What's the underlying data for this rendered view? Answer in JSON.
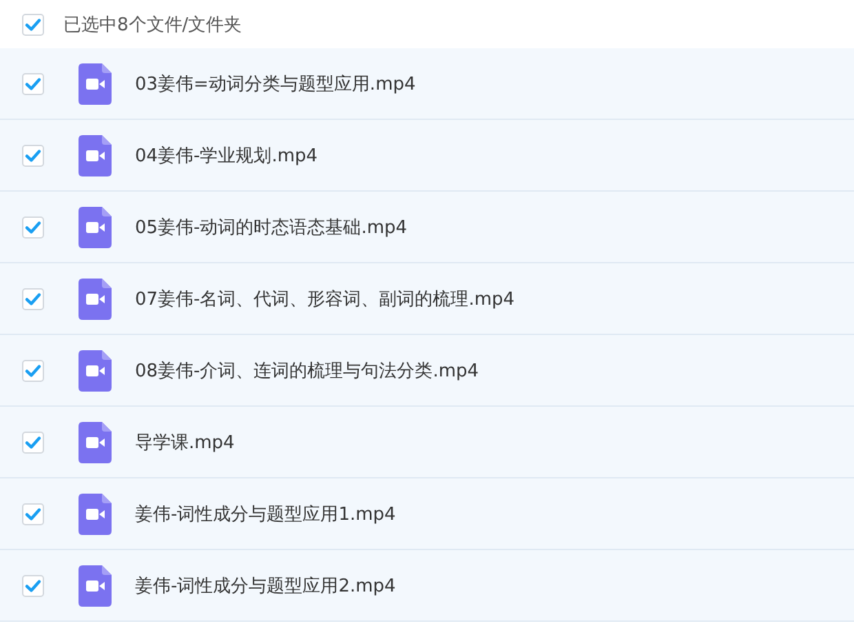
{
  "header": {
    "checked": true,
    "label": "已选中8个文件/文件夹"
  },
  "files": [
    {
      "name": "03姜伟=动词分类与题型应用.mp4",
      "checked": true
    },
    {
      "name": "04姜伟-学业规划.mp4",
      "checked": true
    },
    {
      "name": "05姜伟-动词的时态语态基础.mp4",
      "checked": true
    },
    {
      "name": "07姜伟-名词、代词、形容词、副词的梳理.mp4",
      "checked": true
    },
    {
      "name": "08姜伟-介词、连词的梳理与句法分类.mp4",
      "checked": true
    },
    {
      "name": "导学课.mp4",
      "checked": true
    },
    {
      "name": "姜伟-词性成分与题型应用1.mp4",
      "checked": true
    },
    {
      "name": "姜伟-词性成分与题型应用2.mp4",
      "checked": true
    }
  ]
}
